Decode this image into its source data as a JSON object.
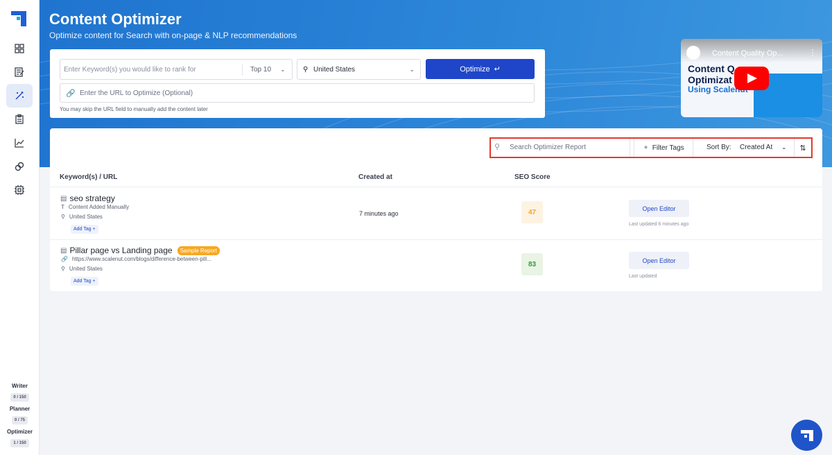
{
  "sidebar": {
    "items": [
      {
        "icon": "dashboard-grid-icon"
      },
      {
        "icon": "writer-edit-icon"
      },
      {
        "icon": "magic-wand-icon",
        "active": true
      },
      {
        "icon": "clipboard-icon"
      },
      {
        "icon": "chart-line-icon"
      },
      {
        "icon": "link-icon"
      },
      {
        "icon": "chip-icon"
      }
    ],
    "usage": [
      {
        "label": "Writer",
        "count": "0 / 150"
      },
      {
        "label": "Planner",
        "count": "0 / 75"
      },
      {
        "label": "Optimizer",
        "count": "1 / 150"
      }
    ]
  },
  "header": {
    "title": "Content Optimizer",
    "subtitle": "Optimize content for Search with on-page & NLP recommendations"
  },
  "search_form": {
    "keyword_placeholder": "Enter Keyword(s) you would like to rank for",
    "top_select": "Top 10",
    "country": "United States",
    "optimize_label": "Optimize",
    "url_placeholder": "Enter the URL to Optimize (Optional)",
    "hint": "You may skip the URL field to manually add the content later"
  },
  "video": {
    "name": "Content Quality Op...",
    "title_line1": "Content Q",
    "title_line2": "Optimizat",
    "title_line3": "Using Scalenut"
  },
  "toolbar": {
    "search_placeholder": "Search Optimizer Report",
    "filter_label": "Filter Tags",
    "sort_label": "Sort By:",
    "sort_value": "Created At"
  },
  "table": {
    "headers": {
      "keyword": "Keyword(s) / URL",
      "created": "Created at",
      "score": "SEO Score"
    },
    "rows": [
      {
        "keyword": "seo strategy",
        "badge": "",
        "source": "Content Added Manually",
        "country": "United States",
        "tag_label": "Add Tag +",
        "created": "7 minutes ago",
        "score": "47",
        "score_color": "#f2a33a",
        "score_bg": "#fdf3e2",
        "action": "Open Editor",
        "updated": "Last updated 6 minutes ago"
      },
      {
        "keyword": "Pillar page vs Landing page",
        "badge": "Sample Report",
        "source": "https://www.scalenut.com/blogs/difference-between-pill...",
        "country": "United States",
        "tag_label": "Add Tag +",
        "created": "",
        "score": "83",
        "score_color": "#2e9a3d",
        "score_bg": "#e9f4e4",
        "action": "Open Editor",
        "updated": "Last updated"
      }
    ]
  },
  "colors": {
    "brand": "#1f46c9",
    "banner": "#2c86d8",
    "highlight": "#e23a2d"
  }
}
